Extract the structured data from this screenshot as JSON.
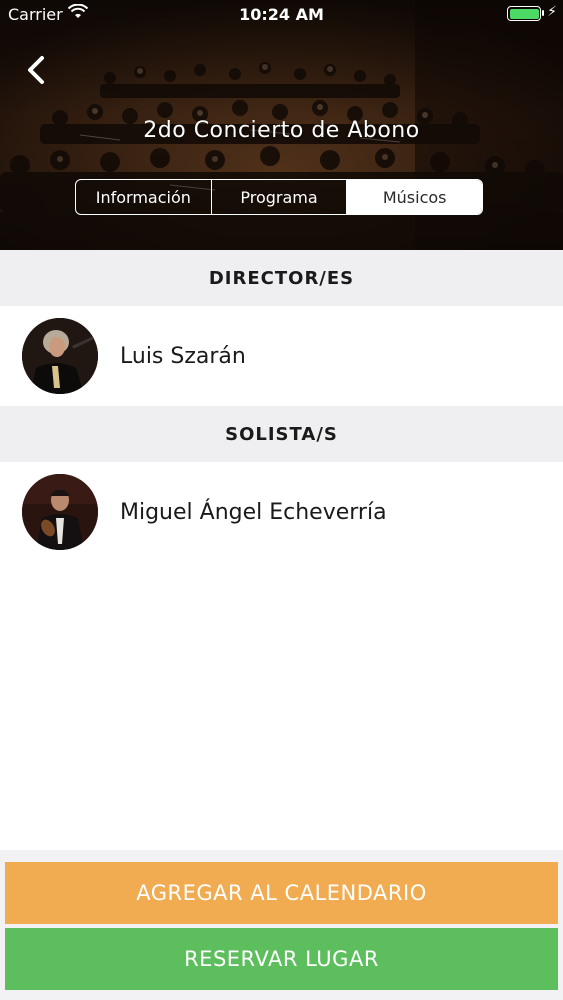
{
  "status_bar": {
    "carrier": "Carrier",
    "time": "10:24 AM"
  },
  "header": {
    "title": "2do Concierto de Abono",
    "tabs": [
      {
        "label": "Información",
        "active": false
      },
      {
        "label": "Programa",
        "active": false
      },
      {
        "label": "Músicos",
        "active": true
      }
    ]
  },
  "sections": {
    "directors": {
      "title": "DIRECTOR/ES",
      "people": [
        {
          "name": "Luis Szarán"
        }
      ]
    },
    "soloists": {
      "title": "SOLISTA/S",
      "people": [
        {
          "name": "Miguel Ángel Echeverría"
        }
      ]
    }
  },
  "actions": {
    "calendar_label": "AGREGAR AL CALENDARIO",
    "reserve_label": "RESERVAR LUGAR"
  },
  "colors": {
    "calendar_button": "#f1ac52",
    "reserve_button": "#5cbe5c",
    "battery": "#4cd964",
    "section_header_bg": "#efeff2"
  },
  "icons": [
    "wifi-icon",
    "battery-icon",
    "charging-bolt-icon",
    "back-chevron-icon"
  ]
}
